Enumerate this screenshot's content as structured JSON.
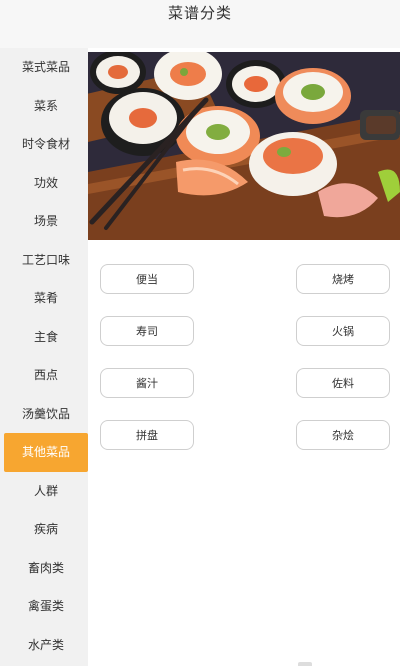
{
  "header": {
    "title": "菜谱分类"
  },
  "sidebar": {
    "items": [
      {
        "label": "菜式菜品"
      },
      {
        "label": "菜系"
      },
      {
        "label": "时令食材"
      },
      {
        "label": "功效"
      },
      {
        "label": "场景"
      },
      {
        "label": "工艺口味"
      },
      {
        "label": "菜肴"
      },
      {
        "label": "主食"
      },
      {
        "label": "西点"
      },
      {
        "label": "汤羹饮品"
      },
      {
        "label": "其他菜品"
      },
      {
        "label": "人群"
      },
      {
        "label": "疾病"
      },
      {
        "label": "畜肉类"
      },
      {
        "label": "禽蛋类"
      },
      {
        "label": "水产类"
      }
    ],
    "active_index": 10,
    "active_color": "#f7a630"
  },
  "banner": {
    "subject": "sushi-illustration"
  },
  "tags": [
    {
      "label": "便当"
    },
    {
      "label": "烧烤"
    },
    {
      "label": "寿司"
    },
    {
      "label": "火锅"
    },
    {
      "label": "酱汁"
    },
    {
      "label": "佐料"
    },
    {
      "label": "拼盘"
    },
    {
      "label": "杂烩"
    }
  ]
}
